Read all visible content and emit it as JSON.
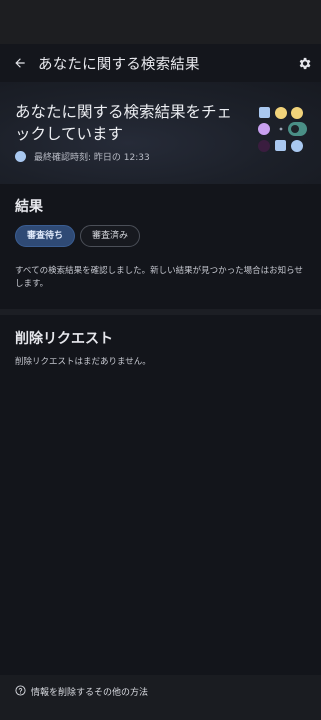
{
  "app_bar": {
    "title": "あなたに関する検索結果",
    "back_icon": "arrow-back-icon",
    "settings_icon": "gear-icon"
  },
  "hero": {
    "headline": "あなたに関する検索結果をチェックしています",
    "last_checked": "最終確認時刻: 昨日の 12:33",
    "status_color": "#a9c8f0"
  },
  "results": {
    "title": "結果",
    "tabs": [
      {
        "label": "審査待ち",
        "selected": true
      },
      {
        "label": "審査済み",
        "selected": false
      }
    ],
    "message": "すべての検索結果を確認しました。新しい結果が見つかった場合はお知らせします。"
  },
  "removal_requests": {
    "title": "削除リクエスト",
    "empty_message": "削除リクエストはまだありません。"
  },
  "footer": {
    "help_icon": "help-circle-icon",
    "label": "情報を削除するその他の方法"
  },
  "colors": {
    "background": "#13151b",
    "accent": "#2f4a75"
  }
}
